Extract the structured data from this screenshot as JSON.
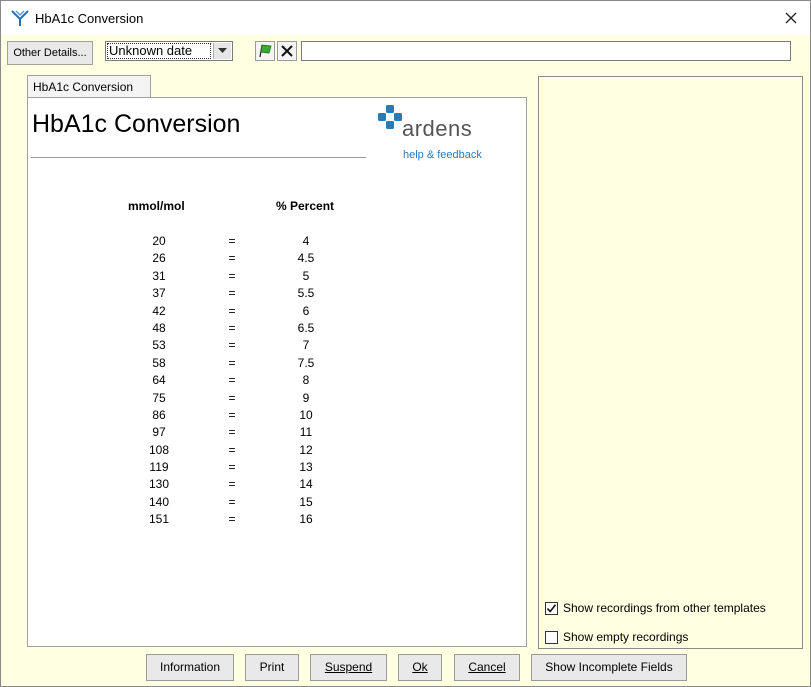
{
  "window": {
    "title": "HbA1c Conversion",
    "close_glyph": "✕"
  },
  "toolbar": {
    "other_details_label": "Other Details...",
    "date_value": "Unknown date",
    "flag_icon": "green-flag-icon",
    "clear_icon": "x-icon",
    "free_text_value": ""
  },
  "tab": {
    "label": "HbA1c Conversion"
  },
  "content": {
    "title": "HbA1c Conversion",
    "logo_word": "ardens",
    "help_link": "help & feedback",
    "col_mmol": "mmol/mol",
    "col_percent": "% Percent",
    "equals": "=",
    "rows": [
      {
        "mmol": "20",
        "pct": "4"
      },
      {
        "mmol": "26",
        "pct": "4.5"
      },
      {
        "mmol": "31",
        "pct": "5"
      },
      {
        "mmol": "37",
        "pct": "5.5"
      },
      {
        "mmol": "42",
        "pct": "6"
      },
      {
        "mmol": "48",
        "pct": "6.5"
      },
      {
        "mmol": "53",
        "pct": "7"
      },
      {
        "mmol": "58",
        "pct": "7.5"
      },
      {
        "mmol": "64",
        "pct": "8"
      },
      {
        "mmol": "75",
        "pct": "9"
      },
      {
        "mmol": "86",
        "pct": "10"
      },
      {
        "mmol": "97",
        "pct": "11"
      },
      {
        "mmol": "108",
        "pct": "12"
      },
      {
        "mmol": "119",
        "pct": "13"
      },
      {
        "mmol": "130",
        "pct": "14"
      },
      {
        "mmol": "140",
        "pct": "15"
      },
      {
        "mmol": "151",
        "pct": "16"
      }
    ]
  },
  "side_panel": {
    "show_other_templates_label": "Show recordings from other templates",
    "show_other_templates_checked": true,
    "show_empty_label": "Show empty recordings",
    "show_empty_checked": false
  },
  "buttons": {
    "information": "Information",
    "print": "Print",
    "suspend": "Suspend",
    "ok": "Ok",
    "cancel": "Cancel",
    "show_incomplete": "Show Incomplete Fields"
  },
  "colors": {
    "window_bg": "#ffffe1",
    "logo_blue": "#2a7ab8"
  }
}
